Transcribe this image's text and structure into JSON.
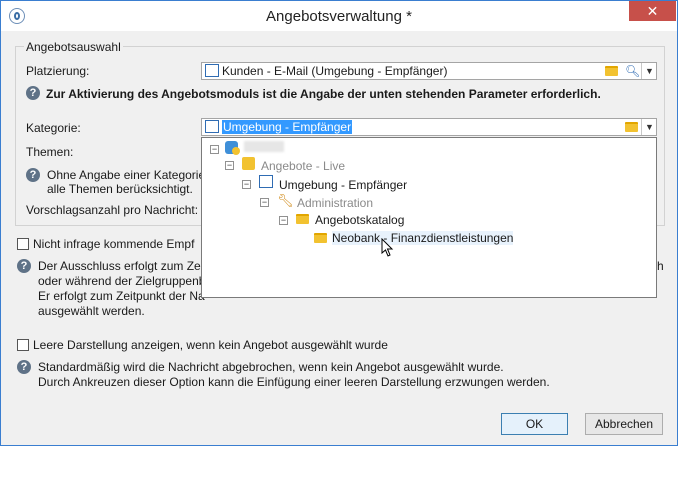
{
  "window": {
    "title": "Angebotsverwaltung *",
    "close_glyph": "✕",
    "min_glyph": "—",
    "max_glyph": "☐"
  },
  "groupbox": {
    "legend": "Angebotsauswahl"
  },
  "placement": {
    "label": "Platzierung:",
    "value": "Kunden - E-Mail (Umgebung - Empfänger)"
  },
  "info1": "Zur Aktivierung des Angebotsmoduls ist die Angabe der unten stehenden Parameter erforderlich.",
  "category": {
    "label": "Kategorie:",
    "value": "Umgebung - Empfänger"
  },
  "themes": {
    "label": "Themen:"
  },
  "info2": {
    "line1": "Ohne Angabe einer Kategorie",
    "line2": "alle Themen berücksichtigt."
  },
  "proposals": {
    "label": "Vorschlagsanzahl pro Nachricht:"
  },
  "exclusion": {
    "checkbox_label": "Nicht infrage kommende Empf",
    "line1": "Der Ausschluss erfolgt zum Zeit",
    "line1_tail": "h",
    "line2": "oder während der Zielgruppenb",
    "line3": "Er erfolgt zum Zeitpunkt der Na",
    "line4": "ausgewählt werden."
  },
  "empty_display": {
    "checkbox_label": "Leere Darstellung anzeigen, wenn kein Angebot ausgewählt wurde",
    "line1": "Standardmäßig wird die Nachricht abgebrochen, wenn kein Angebot ausgewählt wurde.",
    "line2": "Durch Ankreuzen dieser Option kann die Einfügung einer leeren Darstellung erzwungen werden."
  },
  "tree": {
    "root": "",
    "offers_live": "Angebote - Live",
    "env_recipient": "Umgebung - Empfänger",
    "administration": "Administration",
    "catalog": "Angebotskatalog",
    "neobank": "Neobank - Finanzdienstleistungen"
  },
  "buttons": {
    "ok": "OK",
    "cancel": "Abbrechen"
  },
  "colors": {
    "accent": "#3399ff",
    "close": "#c7504a",
    "border": "#3a7ed0"
  }
}
